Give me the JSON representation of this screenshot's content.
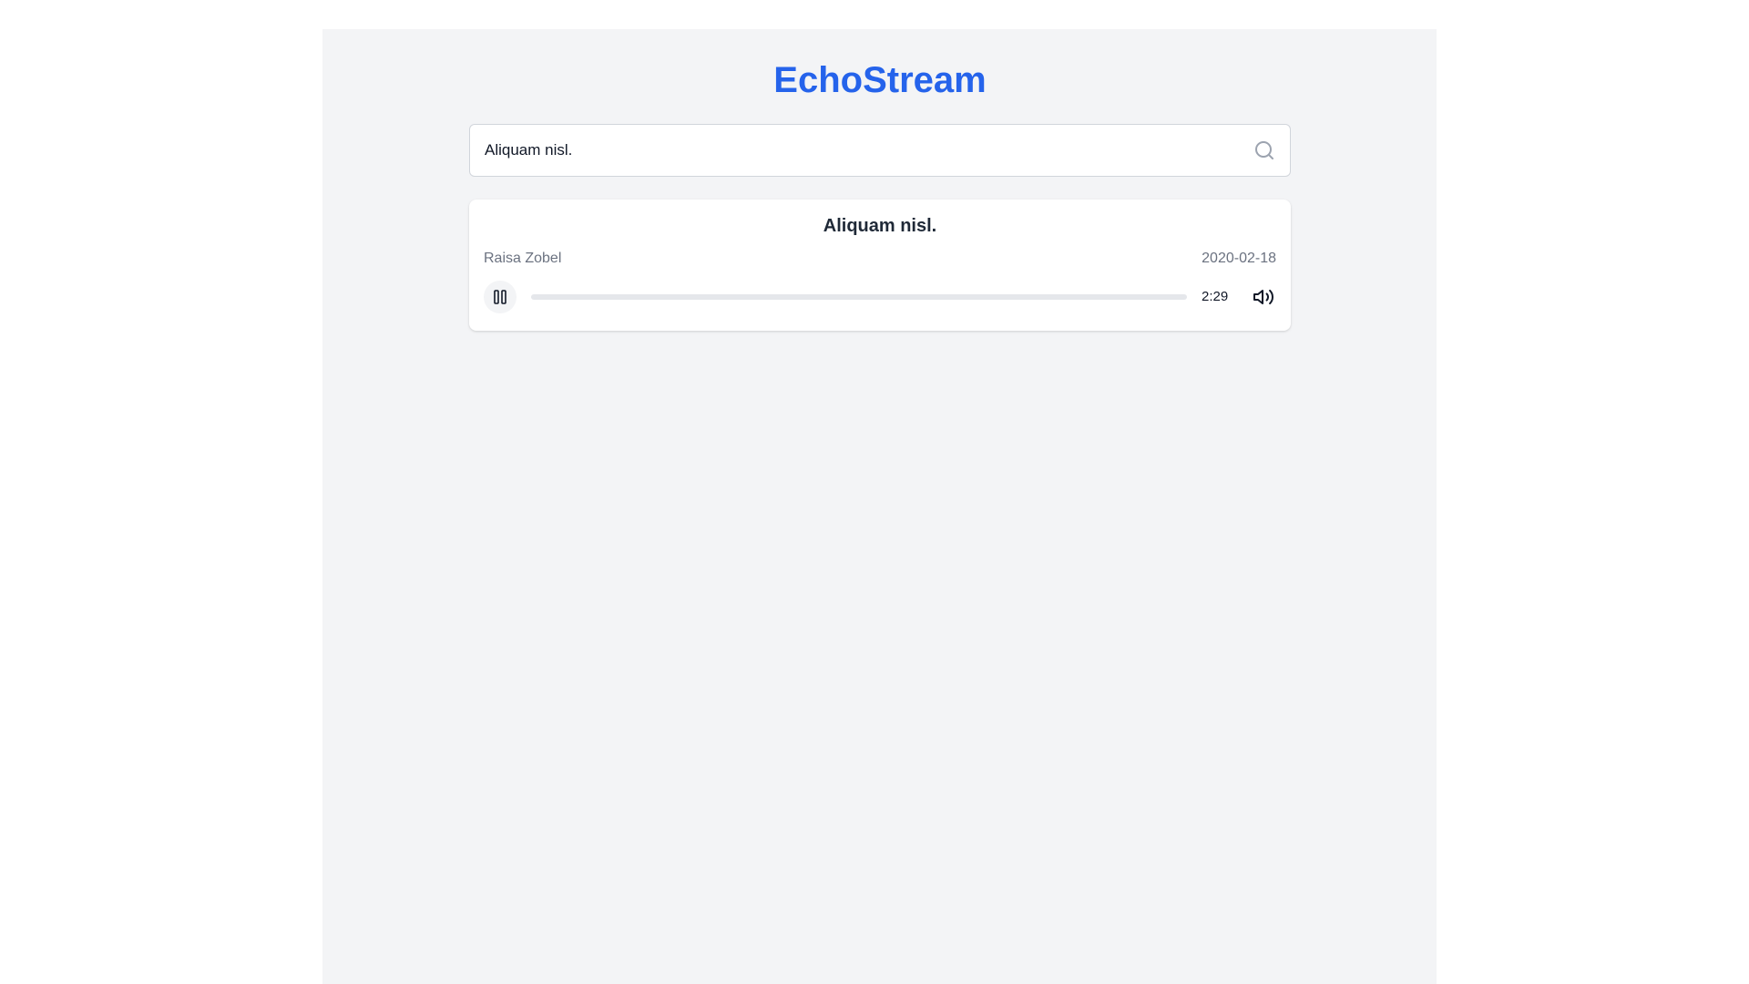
{
  "app": {
    "title": "EchoStream",
    "brand_color": "#2563eb"
  },
  "search": {
    "value": "Aliquam nisl.",
    "icon": "search-icon"
  },
  "track": {
    "title": "Aliquam nisl.",
    "artist": "Raisa Zobel",
    "date": "2020-02-18",
    "duration": "2:29",
    "progress": 0,
    "is_playing": true,
    "play_state_icon": "pause-icon",
    "volume_icon": "volume-icon"
  }
}
